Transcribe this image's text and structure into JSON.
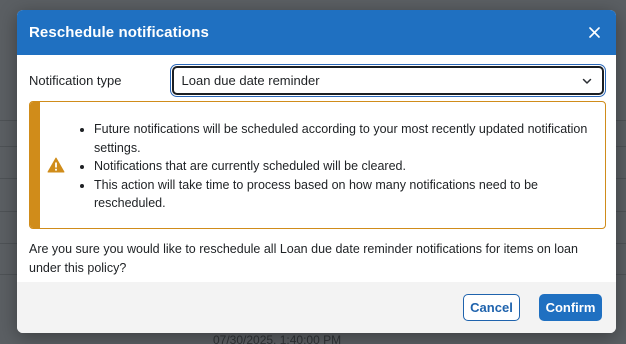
{
  "background": {
    "timestamp": "07/30/2025, 1:40:00 PM"
  },
  "modal": {
    "title": "Reschedule notifications",
    "close_icon": "close-icon",
    "notification_type": {
      "label": "Notification type",
      "selected": "Loan due date reminder"
    },
    "warning": {
      "icon": "warning-triangle-icon",
      "items": [
        "Future notifications will be scheduled according to your most recently updated notification settings.",
        "Notifications that are currently scheduled will be cleared.",
        "This action will take time to process based on how many notifications need to be rescheduled."
      ]
    },
    "confirm_message": "Are you sure you would like to reschedule all Loan due date reminder notifications for items on loan under this policy?",
    "buttons": {
      "cancel": "Cancel",
      "confirm": "Confirm"
    }
  },
  "colors": {
    "header": "#1f70c1",
    "warning": "#d08c1a",
    "overlay": "#5b5f63"
  }
}
